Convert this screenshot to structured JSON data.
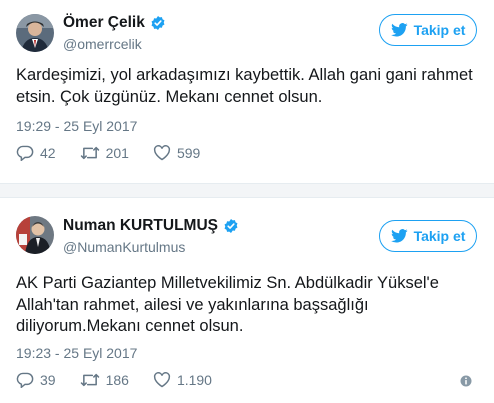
{
  "colors": {
    "accent": "#1da1f2",
    "muted": "#657786",
    "text": "#14171a"
  },
  "tweets": [
    {
      "display_name": "Ömer Çelik",
      "handle": "@omerrcelik",
      "follow_label": "Takip et",
      "text": "Kardeşimizi, yol arkadaşımızı kaybettik. Allah gani gani rahmet etsin. Çok üzgünüz. Mekanı cennet olsun.",
      "timestamp": "19:29 - 25 Eyl 2017",
      "replies": "42",
      "retweets": "201",
      "likes": "599",
      "icons": {
        "verified": "verified-badge-icon",
        "follow": "twitter-bird-icon",
        "reply": "reply-icon",
        "retweet": "retweet-icon",
        "like": "heart-icon"
      }
    },
    {
      "display_name": "Numan KURTULMUŞ",
      "handle": "@NumanKurtulmus",
      "follow_label": "Takip et",
      "text": "AK Parti Gaziantep Milletvekilimiz Sn. Abdülkadir Yüksel'e Allah'tan rahmet, ailesi ve yakınlarına başsağlığı diliyorum.Mekanı cennet olsun.",
      "timestamp": "19:23 - 25 Eyl 2017",
      "replies": "39",
      "retweets": "186",
      "likes": "1.190",
      "icons": {
        "verified": "verified-badge-icon",
        "follow": "twitter-bird-icon",
        "reply": "reply-icon",
        "retweet": "retweet-icon",
        "like": "heart-icon",
        "info": "info-icon"
      }
    }
  ]
}
